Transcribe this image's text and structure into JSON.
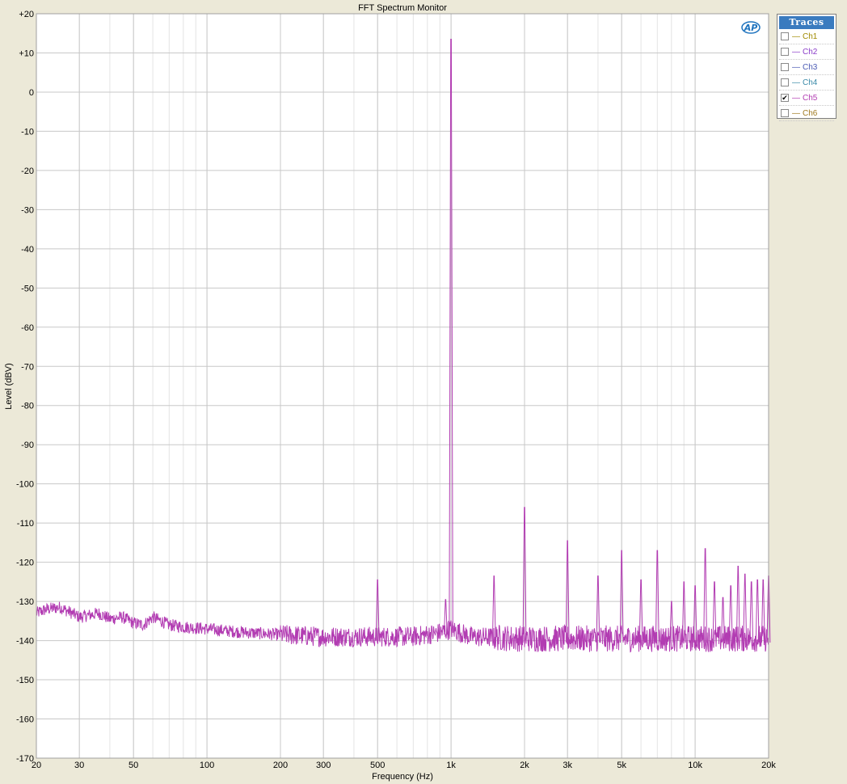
{
  "chart_data": {
    "type": "line",
    "title": "FFT Spectrum Monitor",
    "xlabel": "Frequency (Hz)",
    "ylabel": "Level (dBV)",
    "xscale": "log",
    "xlim": [
      20,
      20000
    ],
    "ylim": [
      -170,
      20
    ],
    "grid": true,
    "x_ticks": [
      {
        "value": 20,
        "label": "20"
      },
      {
        "value": 30,
        "label": "30"
      },
      {
        "value": 50,
        "label": "50"
      },
      {
        "value": 100,
        "label": "100"
      },
      {
        "value": 200,
        "label": "200"
      },
      {
        "value": 300,
        "label": "300"
      },
      {
        "value": 500,
        "label": "500"
      },
      {
        "value": 1000,
        "label": "1k"
      },
      {
        "value": 2000,
        "label": "2k"
      },
      {
        "value": 3000,
        "label": "3k"
      },
      {
        "value": 5000,
        "label": "5k"
      },
      {
        "value": 10000,
        "label": "10k"
      },
      {
        "value": 20000,
        "label": "20k"
      }
    ],
    "y_ticks": [
      {
        "value": 20,
        "label": "+20"
      },
      {
        "value": 10,
        "label": "+10"
      },
      {
        "value": 0,
        "label": "0"
      },
      {
        "value": -10,
        "label": "-10"
      },
      {
        "value": -20,
        "label": "-20"
      },
      {
        "value": -30,
        "label": "-30"
      },
      {
        "value": -40,
        "label": "-40"
      },
      {
        "value": -50,
        "label": "-50"
      },
      {
        "value": -60,
        "label": "-60"
      },
      {
        "value": -70,
        "label": "-70"
      },
      {
        "value": -80,
        "label": "-80"
      },
      {
        "value": -90,
        "label": "-90"
      },
      {
        "value": -100,
        "label": "-100"
      },
      {
        "value": -110,
        "label": "-110"
      },
      {
        "value": -120,
        "label": "-120"
      },
      {
        "value": -130,
        "label": "-130"
      },
      {
        "value": -140,
        "label": "-140"
      },
      {
        "value": -150,
        "label": "-150"
      },
      {
        "value": -160,
        "label": "-160"
      },
      {
        "value": -170,
        "label": "-170"
      }
    ],
    "series": [
      {
        "name": "Ch5",
        "color": "#b23cb2",
        "noise_floor": [
          [
            20,
            -133
          ],
          [
            22,
            -132
          ],
          [
            25,
            -131.5
          ],
          [
            28,
            -133
          ],
          [
            30,
            -134
          ],
          [
            33,
            -133.5
          ],
          [
            36,
            -133
          ],
          [
            40,
            -134.5
          ],
          [
            45,
            -134
          ],
          [
            50,
            -135.5
          ],
          [
            55,
            -136
          ],
          [
            60,
            -134
          ],
          [
            70,
            -136
          ],
          [
            80,
            -136.5
          ],
          [
            100,
            -137
          ],
          [
            120,
            -137.5
          ],
          [
            150,
            -138
          ],
          [
            200,
            -138.5
          ],
          [
            300,
            -139
          ],
          [
            500,
            -139
          ],
          [
            700,
            -139
          ],
          [
            900,
            -138
          ],
          [
            1000,
            -137
          ],
          [
            1200,
            -139
          ],
          [
            2000,
            -139.5
          ],
          [
            5000,
            -139.5
          ],
          [
            10000,
            -139.5
          ],
          [
            20000,
            -139.5
          ]
        ],
        "peaks": [
          {
            "x": 500,
            "y": -124.5
          },
          {
            "x": 950,
            "y": -129.5
          },
          {
            "x": 1000,
            "y": 13.5
          },
          {
            "x": 1500,
            "y": -123.5
          },
          {
            "x": 2000,
            "y": -106
          },
          {
            "x": 3000,
            "y": -114.5
          },
          {
            "x": 4000,
            "y": -123.5
          },
          {
            "x": 5000,
            "y": -117
          },
          {
            "x": 6000,
            "y": -124.5
          },
          {
            "x": 7000,
            "y": -117
          },
          {
            "x": 8000,
            "y": -130
          },
          {
            "x": 9000,
            "y": -125
          },
          {
            "x": 10000,
            "y": -126
          },
          {
            "x": 11000,
            "y": -116.5
          },
          {
            "x": 12000,
            "y": -125
          },
          {
            "x": 13000,
            "y": -129
          },
          {
            "x": 14000,
            "y": -126
          },
          {
            "x": 15000,
            "y": -121
          },
          {
            "x": 16000,
            "y": -123
          },
          {
            "x": 17000,
            "y": -125
          },
          {
            "x": 18000,
            "y": -124.5
          },
          {
            "x": 19000,
            "y": -124.5
          },
          {
            "x": 20000,
            "y": -123.5
          }
        ]
      }
    ]
  },
  "logo": {
    "text": "AP",
    "color": "#1e73be"
  },
  "traces": {
    "title": "Traces",
    "items": [
      {
        "label": "Ch1",
        "checked": false,
        "color": "#a08a00"
      },
      {
        "label": "Ch2",
        "checked": false,
        "color": "#8a3cc8"
      },
      {
        "label": "Ch3",
        "checked": false,
        "color": "#4a5ab4"
      },
      {
        "label": "Ch4",
        "checked": false,
        "color": "#3a8aa8"
      },
      {
        "label": "Ch5",
        "checked": true,
        "color": "#b23cb2"
      },
      {
        "label": "Ch6",
        "checked": false,
        "color": "#a07a20"
      }
    ]
  }
}
